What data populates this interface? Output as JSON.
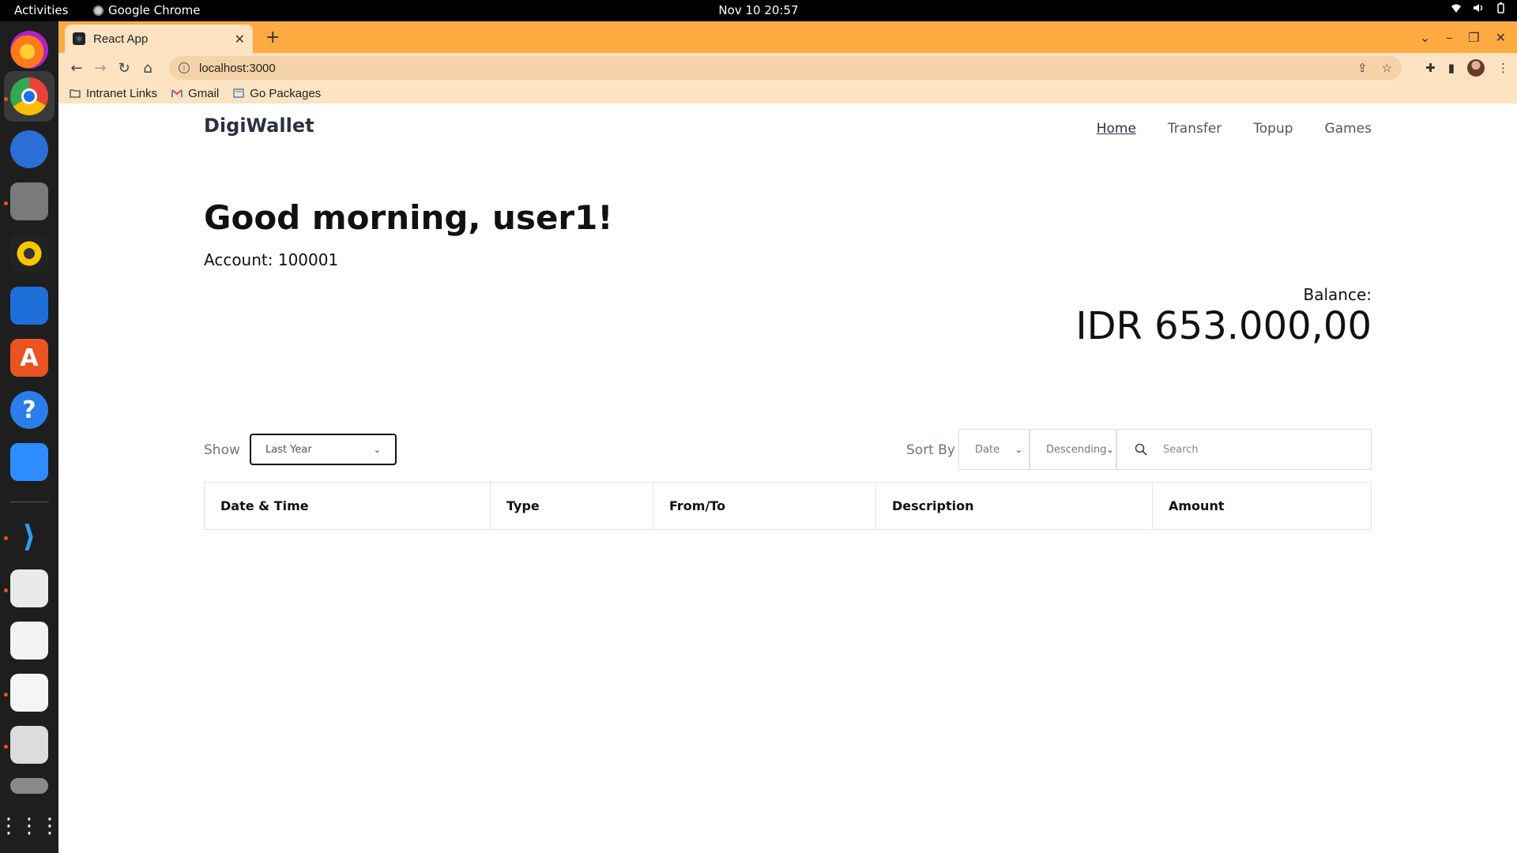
{
  "system": {
    "activities": "Activities",
    "app_name": "Google Chrome",
    "clock": "Nov 10  20:57"
  },
  "browser": {
    "tab_title": "React App",
    "url": "localhost:3000",
    "bookmarks": [
      {
        "label": "Intranet Links",
        "icon": "folder-icon"
      },
      {
        "label": "Gmail",
        "icon": "gmail-icon"
      },
      {
        "label": "Go Packages",
        "icon": "go-packages-icon"
      }
    ]
  },
  "app": {
    "brand": "DigiWallet",
    "nav": [
      {
        "label": "Home",
        "active": true
      },
      {
        "label": "Transfer",
        "active": false
      },
      {
        "label": "Topup",
        "active": false
      },
      {
        "label": "Games",
        "active": false
      }
    ],
    "greeting": "Good morning, user1!",
    "account": "Account: 100001",
    "balance_label": "Balance:",
    "balance_value": "IDR 653.000,00",
    "filters": {
      "show_label": "Show",
      "show_value": "Last Year",
      "sortby_label": "Sort By",
      "sort_field": "Date",
      "sort_order": "Descending",
      "search_placeholder": "Search"
    },
    "table": {
      "columns": [
        "Date & Time",
        "Type",
        "From/To",
        "Description",
        "Amount"
      ]
    }
  },
  "colors": {
    "chrome_frame": "#fdaa41",
    "chrome_toolbar": "#fde3c2",
    "dock": "#1e1e1e",
    "brand_text": "#2b3140"
  }
}
